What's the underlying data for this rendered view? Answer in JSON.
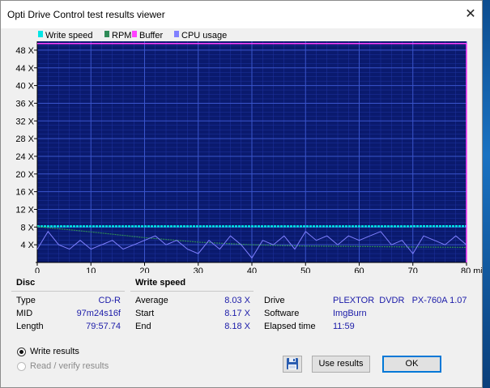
{
  "window": {
    "title": "Opti Drive Control test results viewer"
  },
  "chart_data": {
    "type": "line",
    "legend": [
      {
        "label": "Write speed",
        "color": "#00e5e5"
      },
      {
        "label": "RPM",
        "color": "#2e8b57"
      },
      {
        "label": "Buffer",
        "color": "#ff40ff"
      },
      {
        "label": "CPU usage",
        "color": "#8080ff"
      }
    ],
    "y_ticks": [
      "4 X",
      "8 X",
      "12 X",
      "16 X",
      "20 X",
      "24 X",
      "28 X",
      "32 X",
      "36 X",
      "40 X",
      "44 X",
      "48 X"
    ],
    "x_ticks": [
      "0",
      "10",
      "20",
      "30",
      "40",
      "50",
      "60",
      "70",
      "80 min"
    ],
    "xlim": [
      0,
      80
    ],
    "ylim": [
      0,
      50
    ],
    "grid": true,
    "series": [
      {
        "name": "Write speed",
        "x": [
          0,
          80
        ],
        "y": [
          8.17,
          8.18
        ]
      },
      {
        "name": "RPM",
        "x": [
          0,
          10,
          20,
          30,
          40,
          50,
          60,
          70,
          80
        ],
        "y": [
          8.1,
          6.9,
          5.6,
          4.6,
          4.0,
          3.7,
          3.6,
          3.5,
          3.4
        ]
      },
      {
        "name": "Buffer",
        "x": [
          0,
          80
        ],
        "y": [
          49.5,
          49.5
        ]
      },
      {
        "name": "CPU usage",
        "x": [
          0,
          2,
          4,
          6,
          8,
          10,
          12,
          14,
          16,
          18,
          20,
          22,
          24,
          26,
          28,
          30,
          32,
          34,
          36,
          38,
          40,
          42,
          44,
          46,
          48,
          50,
          52,
          54,
          56,
          58,
          60,
          62,
          64,
          66,
          68,
          70,
          72,
          74,
          76,
          78,
          80
        ],
        "y": [
          3,
          7,
          4,
          3,
          5,
          3,
          4,
          5,
          3,
          4,
          5,
          6,
          4,
          5,
          3,
          2,
          5,
          3,
          6,
          4,
          1,
          5,
          4,
          6,
          3,
          7,
          5,
          6,
          4,
          6,
          5,
          6,
          7,
          4,
          5,
          2,
          6,
          5,
          4,
          6,
          4
        ]
      }
    ]
  },
  "disc": {
    "heading": "Disc",
    "rows": [
      {
        "label": "Type",
        "value": "CD-R"
      },
      {
        "label": "MID",
        "value": "97m24s16f"
      },
      {
        "label": "Length",
        "value": "79:57.74"
      }
    ]
  },
  "write_speed": {
    "heading": "Write speed",
    "rows": [
      {
        "label": "Average",
        "value": "8.03 X"
      },
      {
        "label": "Start",
        "value": "8.17 X"
      },
      {
        "label": "End",
        "value": "8.18 X"
      }
    ]
  },
  "info": {
    "rows": [
      {
        "label": "Drive",
        "value": "PLEXTOR  DVDR   PX-760A 1.07"
      },
      {
        "label": "Software",
        "value": "ImgBurn"
      },
      {
        "label": "Elapsed time",
        "value": "11:59"
      }
    ]
  },
  "options": {
    "write_results": {
      "label": "Write results",
      "checked": true
    },
    "read_verify": {
      "label": "Read / verify results",
      "checked": false
    }
  },
  "buttons": {
    "use_results": "Use results",
    "ok": "OK"
  },
  "icons": {
    "save": "floppy-disk-icon",
    "close": "close-icon"
  }
}
